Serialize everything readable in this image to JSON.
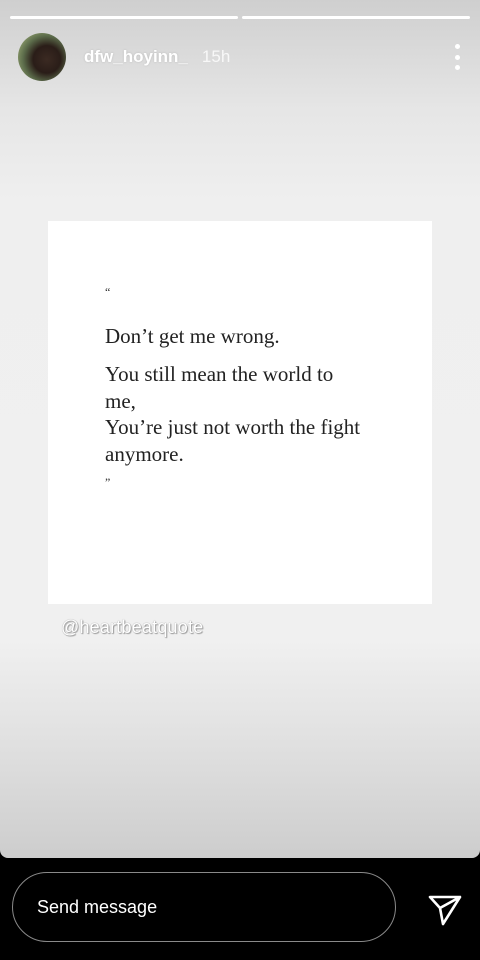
{
  "story": {
    "progress": [
      1.0,
      1.0
    ],
    "user": {
      "username": "dfw_hoyinn_",
      "time": "15h",
      "avatar_icon": "profile-avatar"
    },
    "more_icon": "more-vertical-icon",
    "quote": {
      "open_mark": "“",
      "line1": "Don’t get me wrong.",
      "body": "You still mean the world to me,\nYou’re just not worth the fight anymore.",
      "close_mark": "”"
    },
    "credit": "@heartbeatquote"
  },
  "footer": {
    "send_placeholder": "Send message",
    "send_icon": "paper-plane-icon"
  },
  "colors": {
    "footer_bg": "#000000",
    "card_bg": "#ffffff",
    "progress_fill": "#ffffff"
  }
}
